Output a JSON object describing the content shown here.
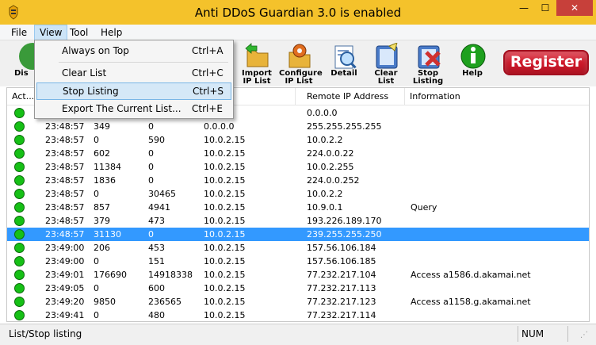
{
  "window": {
    "title": "Anti DDoS Guardian 3.0 is enabled",
    "minimize": "—",
    "maximize": "☐",
    "close": "✕"
  },
  "menubar": [
    "File",
    "View",
    "Tool",
    "Help"
  ],
  "view_menu": [
    {
      "label": "Always on Top",
      "shortcut": "Ctrl+A"
    },
    {
      "label": "Clear List",
      "shortcut": "Ctrl+C"
    },
    {
      "label": "Stop Listing",
      "shortcut": "Ctrl+S"
    },
    {
      "label": "Export The Current List...",
      "shortcut": "Ctrl+E"
    }
  ],
  "toolbar": {
    "first_partial": "Dis",
    "buttons": [
      {
        "label": "Import IP List",
        "icon": "import-ip-list-icon",
        "color": "#e8b33a"
      },
      {
        "label": "Configure IP List",
        "icon": "configure-ip-list-icon",
        "color": "#e06d1f"
      },
      {
        "label": "Detail",
        "icon": "detail-icon",
        "color": "#3a7fd0"
      },
      {
        "label": "Clear List",
        "icon": "clear-list-icon",
        "color": "#4a7bc8"
      },
      {
        "label": "Stop Listing",
        "icon": "stop-listing-icon",
        "color": "#d03030"
      },
      {
        "label": "Help",
        "icon": "help-icon",
        "color": "#1ea01e"
      }
    ],
    "register": "Register"
  },
  "table": {
    "columns": [
      "Act...",
      "",
      "",
      "",
      "Address",
      "Remote IP Address",
      "Information"
    ],
    "rows": [
      {
        "time": "",
        "c1": "",
        "c2": "",
        "local": "",
        "remote": "0.0.0.0",
        "info": ""
      },
      {
        "time": "23:48:57",
        "c1": "349",
        "c2": "0",
        "local": "0.0.0.0",
        "remote": "255.255.255.255",
        "info": ""
      },
      {
        "time": "23:48:57",
        "c1": "0",
        "c2": "590",
        "local": "10.0.2.15",
        "remote": "10.0.2.2",
        "info": ""
      },
      {
        "time": "23:48:57",
        "c1": "602",
        "c2": "0",
        "local": "10.0.2.15",
        "remote": "224.0.0.22",
        "info": ""
      },
      {
        "time": "23:48:57",
        "c1": "11384",
        "c2": "0",
        "local": "10.0.2.15",
        "remote": "10.0.2.255",
        "info": ""
      },
      {
        "time": "23:48:57",
        "c1": "1836",
        "c2": "0",
        "local": "10.0.2.15",
        "remote": "224.0.0.252",
        "info": ""
      },
      {
        "time": "23:48:57",
        "c1": "0",
        "c2": "30465",
        "local": "10.0.2.15",
        "remote": "10.0.2.2",
        "info": ""
      },
      {
        "time": "23:48:57",
        "c1": "857",
        "c2": "4941",
        "local": "10.0.2.15",
        "remote": "10.9.0.1",
        "info": "Query"
      },
      {
        "time": "23:48:57",
        "c1": "379",
        "c2": "473",
        "local": "10.0.2.15",
        "remote": "193.226.189.170",
        "info": ""
      },
      {
        "time": "23:48:57",
        "c1": "31130",
        "c2": "0",
        "local": "10.0.2.15",
        "remote": "239.255.255.250",
        "info": "",
        "selected": true
      },
      {
        "time": "23:49:00",
        "c1": "206",
        "c2": "453",
        "local": "10.0.2.15",
        "remote": "157.56.106.184",
        "info": ""
      },
      {
        "time": "23:49:00",
        "c1": "0",
        "c2": "151",
        "local": "10.0.2.15",
        "remote": "157.56.106.185",
        "info": ""
      },
      {
        "time": "23:49:01",
        "c1": "176690",
        "c2": "14918338",
        "local": "10.0.2.15",
        "remote": "77.232.217.104",
        "info": "Access a1586.d.akamai.net"
      },
      {
        "time": "23:49:05",
        "c1": "0",
        "c2": "600",
        "local": "10.0.2.15",
        "remote": "77.232.217.113",
        "info": ""
      },
      {
        "time": "23:49:20",
        "c1": "9850",
        "c2": "236565",
        "local": "10.0.2.15",
        "remote": "77.232.217.123",
        "info": "Access a1158.g.akamai.net"
      },
      {
        "time": "23:49:41",
        "c1": "0",
        "c2": "480",
        "local": "10.0.2.15",
        "remote": "77.232.217.114",
        "info": ""
      }
    ]
  },
  "status": {
    "text": "List/Stop listing",
    "num": "NUM"
  }
}
